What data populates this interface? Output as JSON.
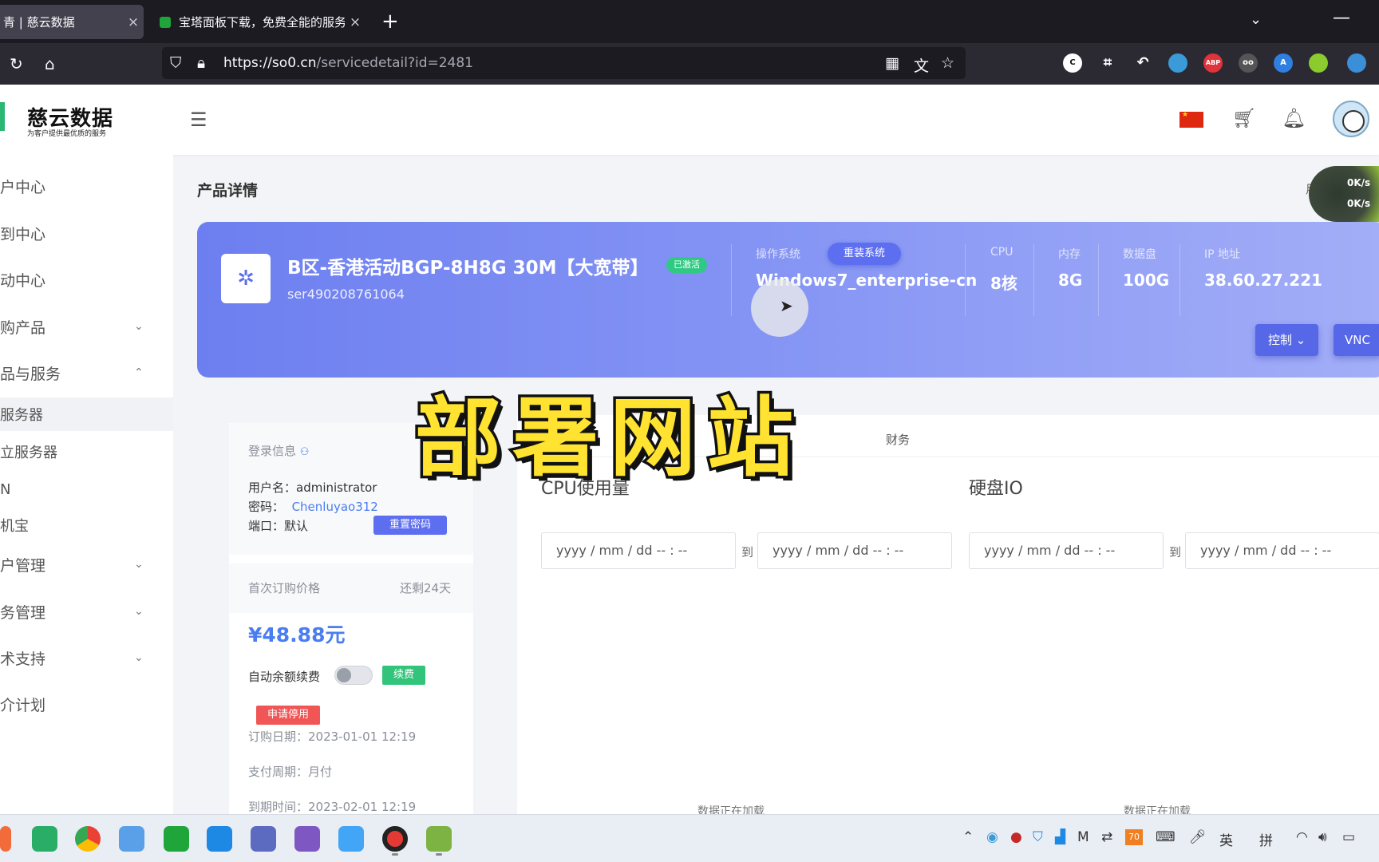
{
  "browser": {
    "tabs": [
      {
        "title": "青 | 慈云数据",
        "active": true,
        "close": "×"
      },
      {
        "title": "宝塔面板下载，免费全能的服务器",
        "active": false,
        "close": "×"
      }
    ],
    "new_tab": "+",
    "url_host": "https://so0.cn",
    "url_path": "/servicedetail?id=2481"
  },
  "header": {
    "logo_text": "慈云数据",
    "logo_sub": "为客户提供最优质的服务",
    "locale": "zh-CN"
  },
  "sidebar": {
    "items": [
      {
        "label": "户中心",
        "chevron": ""
      },
      {
        "label": "到中心",
        "chevron": ""
      },
      {
        "label": "动中心",
        "chevron": ""
      },
      {
        "label": "购产品",
        "chevron": "⌄"
      },
      {
        "label": "品与服务",
        "chevron": "⌃"
      },
      {
        "label": "服务器",
        "chevron": ""
      },
      {
        "label": "立服务器",
        "chevron": ""
      },
      {
        "label": "N",
        "chevron": ""
      },
      {
        "label": "机宝",
        "chevron": ""
      },
      {
        "label": "户管理",
        "chevron": "⌄"
      },
      {
        "label": "务管理",
        "chevron": "⌄"
      },
      {
        "label": "术支持",
        "chevron": "⌄"
      },
      {
        "label": "介计划",
        "chevron": ""
      }
    ]
  },
  "page": {
    "title": "产品详情",
    "speed": {
      "label": "用",
      "up": "0K/s",
      "down": "0K/s"
    }
  },
  "product": {
    "name": "B区-香港活动BGP-8H8G 30M【大宽带】",
    "status": "已激活",
    "id": "ser490208761064",
    "os_label": "操作系统",
    "reinstall_label": "重装系统",
    "os_value": "Windows7_enterprise-cn",
    "cpu_label": "CPU",
    "cpu_value": "8核",
    "mem_label": "内存",
    "mem_value": "8G",
    "disk_label": "数据盘",
    "disk_value": "100G",
    "ip_label": "IP 地址",
    "ip_value": "38.60.27.221",
    "control_label": "控制 ⌄",
    "vnc_label": "VNC"
  },
  "login": {
    "heading": "登录信息",
    "username_label": "用户名：",
    "username": "administrator",
    "password_label": "密码：",
    "password": "Chenluyao312",
    "port_label": "端口：",
    "port": "默认",
    "reset_label": "重置密码"
  },
  "billing": {
    "first_price_label": "首次订购价格",
    "remaining": "还剩24天",
    "price": "¥48.88元",
    "auto_renew_label": "自动余额续费",
    "auto_renew_on": false,
    "renew_label": "续费",
    "suspend_label": "申请停用",
    "order_date": "订购日期：2023-01-01 12:19",
    "pay_cycle": "支付周期：月付",
    "expire": "到期时间：2023-02-01 12:19"
  },
  "monitor": {
    "finance_tab": "财务",
    "cpu_title": "CPU使用量",
    "disk_title": "硬盘IO",
    "date_placeholder": "yyyy / mm / dd   -- : --",
    "to_label": "到",
    "loading_text": "数据正在加载"
  },
  "overlay": {
    "text": "部署网站"
  },
  "taskbar": {
    "tray_ime_lang": "英",
    "tray_ime_mode": "拼",
    "tray_badge": "70"
  }
}
